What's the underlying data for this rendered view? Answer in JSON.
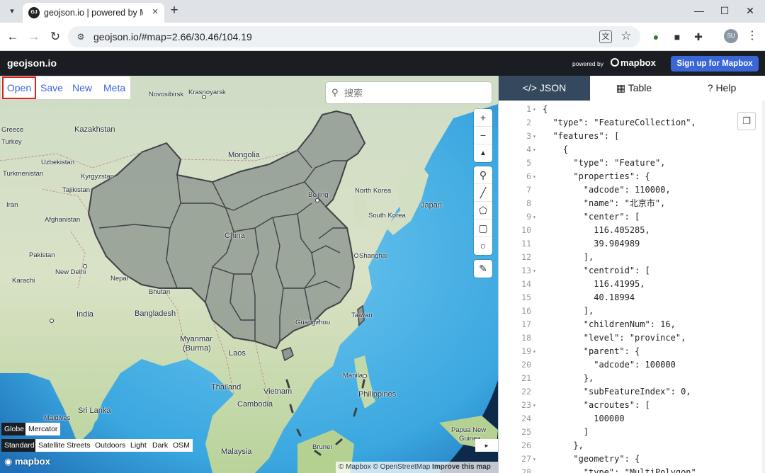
{
  "browser": {
    "tab_title": "geojson.io | powered by Mapbox",
    "favicon_text": "GJ",
    "url": "geojson.io/#map=2.66/30.46/104.19",
    "profile_initials": "SU",
    "window_buttons": [
      "—",
      "☐",
      "✕"
    ]
  },
  "app": {
    "logo": "geojson.io",
    "powered_by": "powered by",
    "mapbox_brand": "mapbox",
    "signup_label": "Sign up for Mapbox"
  },
  "file_menu": [
    "Open",
    "Save",
    "New",
    "Meta"
  ],
  "search": {
    "placeholder": "搜索"
  },
  "map": {
    "zoom_in": "+",
    "zoom_out": "−",
    "compass": "▲",
    "draw_tools": [
      "marker-icon",
      "line-icon",
      "polygon-icon",
      "rectangle-icon",
      "circle-icon"
    ],
    "edit_tool": "edit-icon",
    "projection_options": [
      "Globe",
      "Mercator"
    ],
    "projection_selected": "Globe",
    "style_options": [
      "Standard",
      "Satellite Streets",
      "Outdoors",
      "Light",
      "Dark",
      "OSM"
    ],
    "style_selected": "Standard",
    "bottom_logo": "mapbox",
    "attribution_mapbox": "© Mapbox",
    "attribution_osm": "© OpenStreetMap",
    "attribution_improve": "Improve this map",
    "collapse_arrow": "▸",
    "labels": [
      {
        "text": "Novosibirsk"
      },
      {
        "text": "Krasnoyarsk"
      },
      {
        "text": "Kazakhstan"
      },
      {
        "text": "Greece"
      },
      {
        "text": "Turkey"
      },
      {
        "text": "Uzbekistan"
      },
      {
        "text": "Turkmenistan"
      },
      {
        "text": "Kyrgyzstan"
      },
      {
        "text": "Tajikistan"
      },
      {
        "text": "Mongolia"
      },
      {
        "text": "Iran"
      },
      {
        "text": "Afghanistan"
      },
      {
        "text": "Pakistan"
      },
      {
        "text": "New Delhi"
      },
      {
        "text": "Karachi"
      },
      {
        "text": "Nepal"
      },
      {
        "text": "Bhutan"
      },
      {
        "text": "India"
      },
      {
        "text": "Bangladesh"
      },
      {
        "text": "China"
      },
      {
        "text": "Beijing"
      },
      {
        "text": "North Korea"
      },
      {
        "text": "South Korea"
      },
      {
        "text": "Japan"
      },
      {
        "text": "Shanghai"
      },
      {
        "text": "Taiwan"
      },
      {
        "text": "Guangzhou"
      },
      {
        "text": "Myanmar"
      },
      {
        "text": "(Burma)"
      },
      {
        "text": "Laos"
      },
      {
        "text": "Manila"
      },
      {
        "text": "Thailand"
      },
      {
        "text": "Vietnam"
      },
      {
        "text": "Philippines"
      },
      {
        "text": "Cambodia"
      },
      {
        "text": "Sri Lanka"
      },
      {
        "text": "Maldives"
      },
      {
        "text": "Malaysia"
      },
      {
        "text": "Brunei"
      },
      {
        "text": "Papua New"
      },
      {
        "text": "Guinea"
      }
    ]
  },
  "panel": {
    "tabs": [
      {
        "label": "JSON",
        "icon": "</>"
      },
      {
        "label": "Table",
        "icon": "▦"
      },
      {
        "label": "Help",
        "icon": "?"
      }
    ],
    "active_tab": "JSON",
    "copy_icon": "copy-icon",
    "code_lines": [
      {
        "n": "1",
        "fold": true,
        "text": "{"
      },
      {
        "n": "2",
        "fold": false,
        "text": "  \"type\": \"FeatureCollection\","
      },
      {
        "n": "3",
        "fold": true,
        "text": "  \"features\": ["
      },
      {
        "n": "4",
        "fold": true,
        "text": "    {"
      },
      {
        "n": "5",
        "fold": false,
        "text": "      \"type\": \"Feature\","
      },
      {
        "n": "6",
        "fold": true,
        "text": "      \"properties\": {"
      },
      {
        "n": "7",
        "fold": false,
        "text": "        \"adcode\": 110000,"
      },
      {
        "n": "8",
        "fold": false,
        "text": "        \"name\": \"北京市\","
      },
      {
        "n": "9",
        "fold": true,
        "text": "        \"center\": ["
      },
      {
        "n": "10",
        "fold": false,
        "text": "          116.405285,"
      },
      {
        "n": "11",
        "fold": false,
        "text": "          39.904989"
      },
      {
        "n": "12",
        "fold": false,
        "text": "        ],"
      },
      {
        "n": "13",
        "fold": true,
        "text": "        \"centroid\": ["
      },
      {
        "n": "14",
        "fold": false,
        "text": "          116.41995,"
      },
      {
        "n": "15",
        "fold": false,
        "text": "          40.18994"
      },
      {
        "n": "16",
        "fold": false,
        "text": "        ],"
      },
      {
        "n": "17",
        "fold": false,
        "text": "        \"childrenNum\": 16,"
      },
      {
        "n": "18",
        "fold": false,
        "text": "        \"level\": \"province\","
      },
      {
        "n": "19",
        "fold": true,
        "text": "        \"parent\": {"
      },
      {
        "n": "20",
        "fold": false,
        "text": "          \"adcode\": 100000"
      },
      {
        "n": "21",
        "fold": false,
        "text": "        },"
      },
      {
        "n": "22",
        "fold": false,
        "text": "        \"subFeatureIndex\": 0,"
      },
      {
        "n": "23",
        "fold": true,
        "text": "        \"acroutes\": ["
      },
      {
        "n": "24",
        "fold": false,
        "text": "          100000"
      },
      {
        "n": "25",
        "fold": false,
        "text": "        ]"
      },
      {
        "n": "26",
        "fold": false,
        "text": "      },"
      },
      {
        "n": "27",
        "fold": true,
        "text": "      \"geometry\": {"
      },
      {
        "n": "28",
        "fold": false,
        "text": "        \"type\": \"MultiPolygon\","
      }
    ]
  }
}
